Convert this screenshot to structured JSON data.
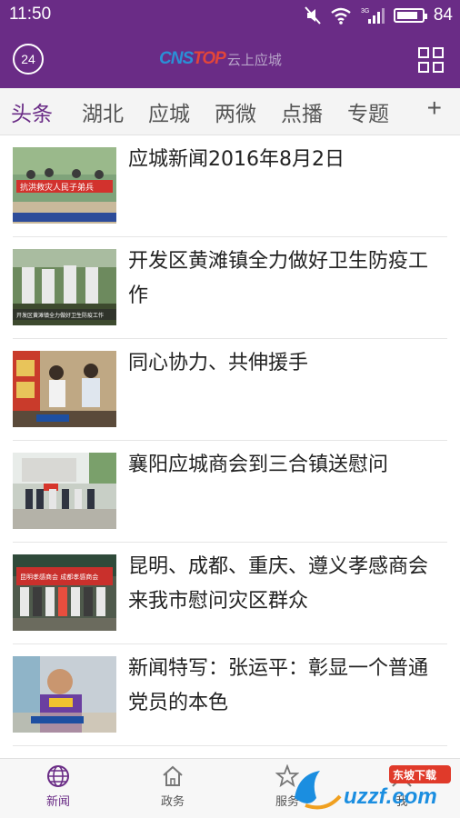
{
  "status_bar": {
    "time": "11:50",
    "battery_percent": "84",
    "battery_level": 0.84,
    "network_label": "3G",
    "icons": [
      "mute-icon",
      "wifi-icon",
      "signal-icon",
      "battery-icon"
    ]
  },
  "header": {
    "badge": "24",
    "logo_brand_a": "CNS",
    "logo_brand_b": "TOP",
    "logo_sub": "云上应城",
    "menu_icon": "grid-icon"
  },
  "colors": {
    "primary": "#6a2c86",
    "brand_blue": "#2a8fd6",
    "brand_red": "#e2453a"
  },
  "tabs": [
    {
      "label": "头条",
      "active": true
    },
    {
      "label": "湖北",
      "active": false
    },
    {
      "label": "应城",
      "active": false
    },
    {
      "label": "两微",
      "active": false
    },
    {
      "label": "点播",
      "active": false
    },
    {
      "label": "专题",
      "active": false
    }
  ],
  "tab_add": "+",
  "news": [
    {
      "title": "应城新闻2016年8月2日",
      "thumb_caption": "抗洪救灾人民子弟兵"
    },
    {
      "title": "开发区黄滩镇全力做好卫生防疫工作",
      "thumb_caption": "开发区黄滩镇全力做好卫生防疫工作"
    },
    {
      "title": "同心协力、共伸援手",
      "thumb_caption": ""
    },
    {
      "title": "襄阳应城商会到三合镇送慰问",
      "thumb_caption": ""
    },
    {
      "title": "昆明、成都、重庆、遵义孝感商会来我市慰问灾区群众",
      "thumb_caption": "昆明孝感商会 成都孝感商会"
    },
    {
      "title": "新闻特写：张运平：彰显一个普通党员的本色",
      "thumb_caption": ""
    }
  ],
  "bottom_nav": [
    {
      "label": "新闻",
      "icon": "globe-icon",
      "active": true
    },
    {
      "label": "政务",
      "icon": "home-icon",
      "active": false
    },
    {
      "label": "服务",
      "icon": "star-icon",
      "active": false
    },
    {
      "label": "我",
      "icon": "person-icon",
      "active": false
    }
  ],
  "watermark": {
    "text": "uzzf.com",
    "tag": "东坡下载"
  }
}
